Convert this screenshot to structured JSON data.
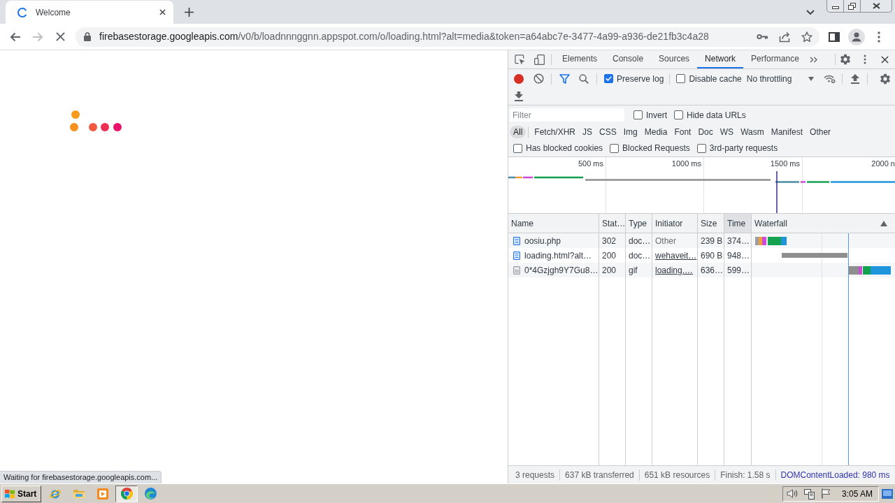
{
  "browser": {
    "tab": {
      "title": "Welcome",
      "loading": true
    },
    "address": {
      "host": "firebasestorage.googleapis.com",
      "path": "/v0/b/loadnnnggnn.appspot.com/o/loading.html?alt=media&token=a64abc7e-3477-4a99-a936-de21fb3c4a28"
    },
    "status": "Waiting for firebasestorage.googleapis.com..."
  },
  "devtools": {
    "tabs": [
      {
        "label": "Elements",
        "selected": false
      },
      {
        "label": "Console",
        "selected": false
      },
      {
        "label": "Sources",
        "selected": false
      },
      {
        "label": "Network",
        "selected": true
      },
      {
        "label": "Performance",
        "selected": false
      }
    ],
    "toolbar": {
      "recording": true,
      "preserve_log": {
        "label": "Preserve log",
        "checked": true
      },
      "disable_cache": {
        "label": "Disable cache",
        "checked": false
      },
      "throttling": "No throttling"
    },
    "filter": {
      "placeholder": "Filter",
      "options": [
        {
          "label": "Invert",
          "checked": false
        },
        {
          "label": "Hide data URLs",
          "checked": false
        }
      ]
    },
    "types": [
      {
        "label": "All",
        "selected": true
      },
      {
        "label": "Fetch/XHR",
        "selected": false
      },
      {
        "label": "JS",
        "selected": false
      },
      {
        "label": "CSS",
        "selected": false
      },
      {
        "label": "Img",
        "selected": false
      },
      {
        "label": "Media",
        "selected": false
      },
      {
        "label": "Font",
        "selected": false
      },
      {
        "label": "Doc",
        "selected": false
      },
      {
        "label": "WS",
        "selected": false
      },
      {
        "label": "Wasm",
        "selected": false
      },
      {
        "label": "Manifest",
        "selected": false
      },
      {
        "label": "Other",
        "selected": false
      }
    ],
    "request_filters": [
      {
        "label": "Has blocked cookies",
        "checked": false
      },
      {
        "label": "Blocked Requests",
        "checked": false
      },
      {
        "label": "3rd-party requests",
        "checked": false
      }
    ],
    "overview": {
      "ticks": [
        "500 ms",
        "1000 ms",
        "1500 ms",
        "2000 n"
      ]
    },
    "table": {
      "columns": [
        {
          "label": "Name",
          "sorted": false
        },
        {
          "label": "Stat…",
          "sorted": false
        },
        {
          "label": "Type",
          "sorted": false
        },
        {
          "label": "Initiator",
          "sorted": false
        },
        {
          "label": "Size",
          "sorted": false
        },
        {
          "label": "Time",
          "sorted": true
        },
        {
          "label": "Waterfall",
          "sorted": false
        }
      ],
      "rows": [
        {
          "kind": "document",
          "name": "oosiu.php",
          "status": "302",
          "type": "doc…",
          "initiator": "Other",
          "initiator_link": false,
          "size": "239 B",
          "time": "374…"
        },
        {
          "kind": "document",
          "name": "loading.html?alt…",
          "status": "200",
          "type": "doc…",
          "initiator": "wehaveit…",
          "initiator_link": true,
          "size": "690 B",
          "time": "948…"
        },
        {
          "kind": "image",
          "name": "0*4Gzjgh9Y7Gu8…",
          "status": "200",
          "type": "gif",
          "initiator": "loading.…",
          "initiator_link": true,
          "size": "636…",
          "time": "599…"
        }
      ]
    },
    "summary": [
      {
        "kind": "stat",
        "text": "3 requests"
      },
      {
        "kind": "stat",
        "text": "637 kB transferred"
      },
      {
        "kind": "stat",
        "text": "651 kB resources"
      },
      {
        "kind": "stat",
        "text": "Finish: 1.58 s"
      },
      {
        "kind": "event",
        "text": "DOMContentLoaded: 980 ms"
      }
    ]
  },
  "taskbar": {
    "start": "Start",
    "apps": [
      {
        "kind": "ie",
        "selected": false
      },
      {
        "kind": "explorer",
        "selected": false
      },
      {
        "kind": "media",
        "selected": false
      },
      {
        "kind": "chrome",
        "selected": true
      },
      {
        "kind": "edge",
        "selected": false
      }
    ],
    "clock": "3:05 AM"
  }
}
